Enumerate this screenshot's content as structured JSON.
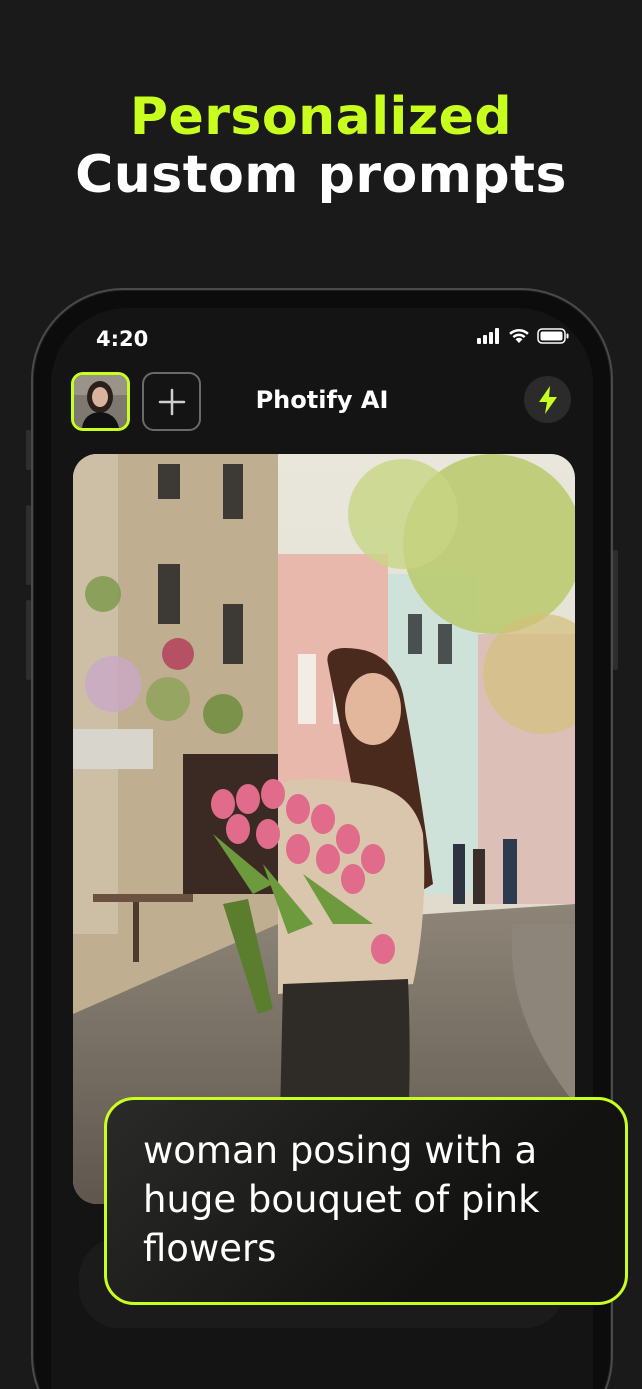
{
  "headline": {
    "line1": "Personalized",
    "line2": "Custom prompts"
  },
  "colors": {
    "accent": "#c9ff1f",
    "background": "#1a1a1a"
  },
  "status_bar": {
    "time": "4:20",
    "icons": [
      "signal-icon",
      "wifi-icon",
      "battery-icon"
    ]
  },
  "app_bar": {
    "title": "Photify AI",
    "avatar_icon": "avatar",
    "add_icon": "plus-icon",
    "action_icon": "lightning-icon"
  },
  "photo": {
    "icon": "generated-photo"
  },
  "prompt": {
    "text": "woman posing with a huge bouquet of pink flowers"
  }
}
